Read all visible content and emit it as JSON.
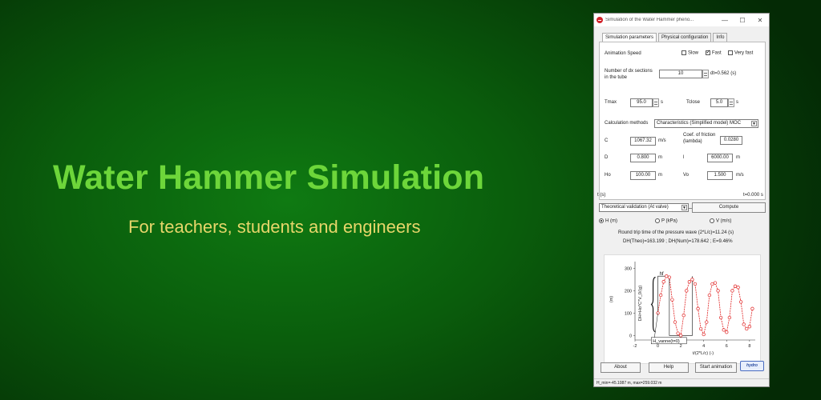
{
  "hero": {
    "title": "Water Hammer Simulation",
    "subtitle": "For teachers, students and engineers"
  },
  "window": {
    "title": "Simulation of the Water Hammer pheno...",
    "min": "—",
    "max": "☐",
    "close": "✕"
  },
  "tabs": [
    "Simulation parameters",
    "Physical configuration",
    "Info"
  ],
  "params": {
    "animation_speed_label": "Animation Speed",
    "speed_slow": "Slow",
    "speed_fast": "Fast",
    "speed_very_fast": "Very fast",
    "dx_label_1": "Number of dx sections",
    "dx_label_2": "in the tube",
    "dx_value": "10",
    "dt_text": "dt=0.562 (s)",
    "tmax_label": "Tmax",
    "tmax_value": "95.0",
    "tmax_unit": "s",
    "tclose_label": "Tclose",
    "tclose_value": "5.0",
    "tclose_unit": "s",
    "calc_label": "Calculation methods",
    "calc_value": "Characteristics (Simplified model) MOC",
    "c_label": "C",
    "c_value": "1067.32",
    "c_unit": "m/s",
    "friction_label_1": "Coef. of friction",
    "friction_label_2": "(lambda)",
    "friction_value": "0.0280",
    "d_label": "D",
    "d_value": "0.800",
    "d_unit": "m",
    "l_label": "l",
    "l_value": "6000.00",
    "l_unit": "m",
    "ho_label": "Ho",
    "ho_value": "100.00",
    "ho_unit": "m",
    "vo_label": "Vo",
    "vo_value": "1.500",
    "vo_unit": "m/s"
  },
  "slider": {
    "left_label": "t (s)",
    "right_label": "t=0.000 s"
  },
  "validation": {
    "select_value": "Theoretical validation (At valve)",
    "compute_label": "Compute",
    "radio_h": "H (m)",
    "radio_p": "P (kPa)",
    "radio_v": "V (m/s)",
    "roundtrip": "Round trip time of the pressure wave (2*L/c)=11.24 (s)",
    "dh_text": "DH(Theo)=163.199 ; DH(Num)=178.642 ; E=9.46%"
  },
  "chart_data": {
    "type": "scatter",
    "ylabel": "DH=Ho*C*V_0/(g)",
    "yunit": "(m)",
    "xlabel": "t/(2*L/c) (-)",
    "xticks": [
      "-2",
      "0",
      "2",
      "4",
      "6",
      "8"
    ],
    "yticks": [
      "300",
      "200",
      "100",
      "0"
    ],
    "xlim": [
      -2,
      8.5
    ],
    "ylim": [
      -20,
      330
    ],
    "annotations": {
      "hf": "hf",
      "h_valve": "H_vanne(t=0)"
    },
    "series": [
      {
        "color": "#e02020",
        "x": [
          0,
          0.25,
          0.5,
          0.75,
          1.0,
          1.25,
          1.5,
          1.75,
          2.0,
          2.25,
          2.5,
          2.75,
          3.0,
          3.25,
          3.5,
          3.75,
          4.0,
          4.25,
          4.5,
          4.75,
          5.0,
          5.25,
          5.5,
          5.75,
          6.0,
          6.25,
          6.5,
          6.75,
          7.0,
          7.25,
          7.5,
          7.75,
          8.0,
          8.25
        ],
        "y": [
          100,
          180,
          240,
          265,
          260,
          160,
          60,
          10,
          0,
          90,
          200,
          240,
          250,
          230,
          120,
          30,
          5,
          60,
          180,
          230,
          235,
          200,
          80,
          25,
          15,
          80,
          200,
          220,
          215,
          150,
          50,
          30,
          40,
          120
        ]
      }
    ]
  },
  "buttons": {
    "about": "About",
    "help": "Help",
    "start": "Start animation",
    "logo": "hydro"
  },
  "status": "H_min=-45.1087 m, max=259.032 m"
}
